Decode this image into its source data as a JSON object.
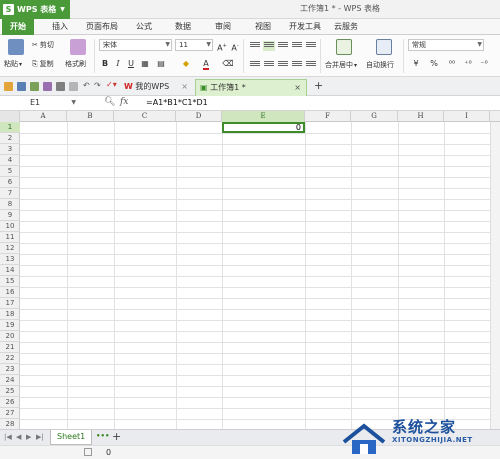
{
  "app": {
    "name": "WPS 表格",
    "logo_letter": "S",
    "window_title": "工作簿1 * - WPS 表格"
  },
  "menu": {
    "tabs": [
      "开始",
      "插入",
      "页面布局",
      "公式",
      "数据",
      "审阅",
      "视图",
      "开发工具",
      "云服务"
    ],
    "active": 0
  },
  "ribbon": {
    "paste": "粘贴",
    "cut": "剪切",
    "copy": "复制",
    "format_painter": "格式刷",
    "font_name": "宋体",
    "font_size": "11",
    "bold": "B",
    "italic": "I",
    "underline": "U",
    "merge_center": "合并居中",
    "wrap_text": "自动换行",
    "number_format": "常规",
    "currency": "¥",
    "percent": "%"
  },
  "docbar": {
    "tabs": [
      {
        "label": "我的WPS",
        "active": false
      },
      {
        "label": "工作簿1 *",
        "active": true
      }
    ],
    "add": "+"
  },
  "formula_bar": {
    "name_box": "E1",
    "fx": "fx",
    "formula": "=A1*B1*C1*D1"
  },
  "grid": {
    "columns": [
      "A",
      "B",
      "C",
      "D",
      "E",
      "F",
      "G",
      "H",
      "I"
    ],
    "selected_column": "E",
    "row_count": 28,
    "selected_row": 1,
    "active_cell_value": "0"
  },
  "sheets": {
    "tabs": [
      "Sheet1"
    ],
    "add": "+",
    "more": "•••"
  },
  "status": {
    "value": "0"
  },
  "watermark": {
    "text": "系统之家",
    "url": "XITONGZHIJIA.NET"
  },
  "colors": {
    "accent": "#4a9a3a",
    "selection": "#cfe6bf",
    "watermark": "#1c4f9c"
  }
}
